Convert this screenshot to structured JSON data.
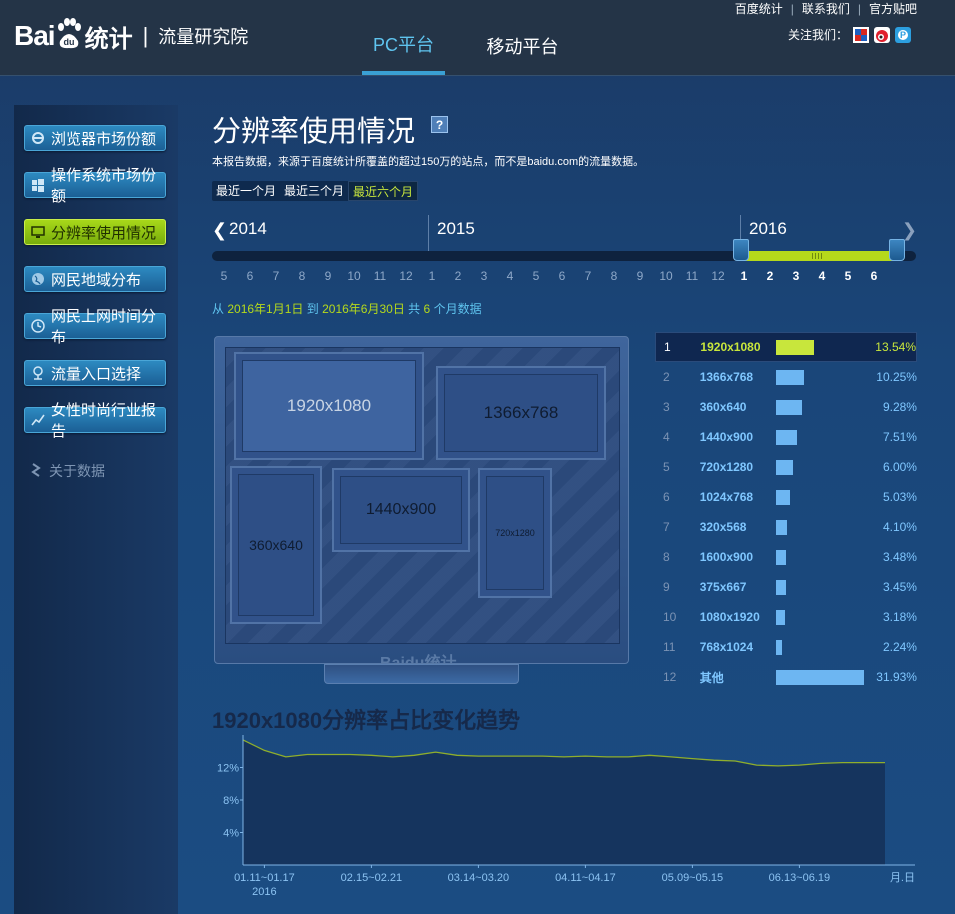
{
  "header": {
    "logo_bai": "Bai",
    "logo_du": "du",
    "logo_tongji": "统计",
    "separator": "|",
    "institute": "流量研究院",
    "tabs": [
      {
        "label": "PC平台",
        "active": true
      },
      {
        "label": "移动平台",
        "active": false
      }
    ],
    "top_links": [
      "百度统计",
      "联系我们",
      "官方贴吧"
    ],
    "follow_label": "关注我们：",
    "social_icons": [
      {
        "name": "plus-icon",
        "color": "#d8281f"
      },
      {
        "name": "weibo-icon",
        "color": "#e0212e"
      },
      {
        "name": "tieba-icon",
        "color": "#2c9fe0"
      }
    ]
  },
  "sidebar": {
    "items": [
      {
        "label": "浏览器市场份额",
        "icon": "ie-icon",
        "active": false
      },
      {
        "label": "操作系统市场份额",
        "icon": "windows-icon",
        "active": false
      },
      {
        "label": "分辨率使用情况",
        "icon": "monitor-icon",
        "active": true
      },
      {
        "label": "网民地域分布",
        "icon": "globe-icon",
        "active": false
      },
      {
        "label": "网民上网时间分布",
        "icon": "clock-icon",
        "active": false
      },
      {
        "label": "流量入口选择",
        "icon": "entrance-icon",
        "active": false
      },
      {
        "label": "女性时尚行业报告",
        "icon": "trend-icon",
        "active": false
      }
    ],
    "about": "关于数据"
  },
  "main": {
    "title": "分辨率使用情况",
    "help": "?",
    "description": "本报告数据，来源于百度统计所覆盖的超过150万的站点，而不是baidu.com的流量数据。",
    "range_tabs": [
      {
        "label": "最近一个月",
        "active": false
      },
      {
        "label": "最近三个月",
        "active": false
      },
      {
        "label": "最近六个月",
        "active": true
      }
    ],
    "timeline": {
      "years": [
        "2014",
        "2015",
        "2016"
      ],
      "months_2014": [
        "5",
        "6",
        "7",
        "8",
        "9",
        "10",
        "11",
        "12"
      ],
      "months_2015": [
        "1",
        "2",
        "3",
        "4",
        "5",
        "6",
        "7",
        "8",
        "9",
        "10",
        "11",
        "12"
      ],
      "months_2016": [
        "1",
        "2",
        "3",
        "4",
        "5",
        "6"
      ],
      "selected_start": "2016-01",
      "selected_end": "2016-06"
    },
    "range_info": {
      "from": "从",
      "start": "2016年1月1日",
      "to": "到",
      "end": "2016年6月30日",
      "total": "共",
      "count": "6",
      "suffix": "个月数据"
    },
    "monitor": {
      "screens": [
        "1920x1080",
        "1366x768",
        "360x640",
        "1440x900",
        "720x1280"
      ],
      "logo": "Baidu统计"
    },
    "ranking": [
      {
        "rank": "1",
        "label": "1920x1080",
        "pct": "13.54%",
        "value": 13.54
      },
      {
        "rank": "2",
        "label": "1366x768",
        "pct": "10.25%",
        "value": 10.25
      },
      {
        "rank": "3",
        "label": "360x640",
        "pct": "9.28%",
        "value": 9.28
      },
      {
        "rank": "4",
        "label": "1440x900",
        "pct": "7.51%",
        "value": 7.51
      },
      {
        "rank": "5",
        "label": "720x1280",
        "pct": "6.00%",
        "value": 6.0
      },
      {
        "rank": "6",
        "label": "1024x768",
        "pct": "5.03%",
        "value": 5.03
      },
      {
        "rank": "7",
        "label": "320x568",
        "pct": "4.10%",
        "value": 4.1
      },
      {
        "rank": "8",
        "label": "1600x900",
        "pct": "3.48%",
        "value": 3.48
      },
      {
        "rank": "9",
        "label": "375x667",
        "pct": "3.45%",
        "value": 3.45
      },
      {
        "rank": "10",
        "label": "1080x1920",
        "pct": "3.18%",
        "value": 3.18
      },
      {
        "rank": "11",
        "label": "768x1024",
        "pct": "2.24%",
        "value": 2.24
      },
      {
        "rank": "12",
        "label": "其他",
        "pct": "31.93%",
        "value": 31.93
      }
    ],
    "trend_title": "1920x1080分辨率占比变化趋势"
  },
  "chart_data": {
    "type": "area",
    "title": "1920x1080分辨率占比变化趋势",
    "xlabel": "月.日",
    "ylabel": "",
    "y_ticks": [
      "4%",
      "8%",
      "12%"
    ],
    "ylim": [
      0,
      16
    ],
    "x_ticks": [
      "01.11~01.17",
      "02.15~02.21",
      "03.14~03.20",
      "04.11~04.17",
      "05.09~05.15",
      "06.13~06.19"
    ],
    "x_sublabel": "2016",
    "values": [
      15.4,
      14.1,
      13.3,
      13.6,
      13.6,
      13.6,
      13.5,
      13.3,
      13.5,
      13.9,
      13.5,
      13.4,
      13.4,
      13.4,
      13.4,
      13.3,
      13.4,
      13.3,
      13.3,
      13.5,
      13.3,
      13.1,
      12.9,
      12.8,
      12.3,
      12.2,
      12.3,
      12.5,
      12.6,
      12.6,
      12.6
    ],
    "line_color": "#8fae2c",
    "fill_color": "#15345e"
  }
}
